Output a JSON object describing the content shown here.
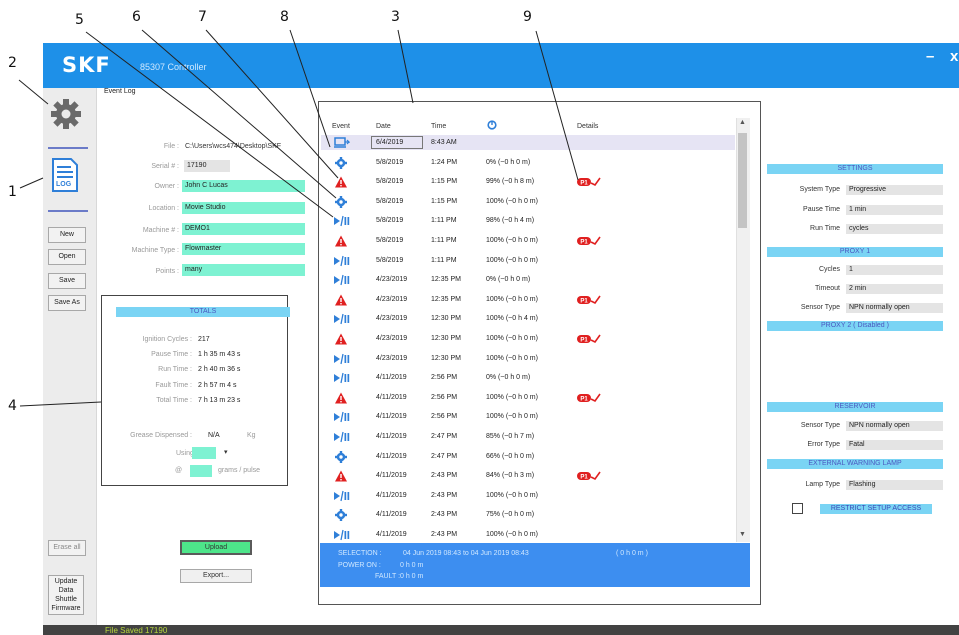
{
  "callouts": [
    "1",
    "2",
    "3",
    "4",
    "5",
    "6",
    "7",
    "8",
    "9"
  ],
  "window": {
    "logo_text": "SKF",
    "app_title": "85307 Controller",
    "minimize": "–",
    "close": "x"
  },
  "sidebar": {
    "log_label": "LOG",
    "buttons": [
      "New",
      "Open",
      "Save",
      "Save As"
    ],
    "erase_all": "Erase all",
    "update_lines": [
      "Update",
      "Data",
      "Shuttle",
      "Firmware"
    ]
  },
  "event_log_tab": "Event Log",
  "form": [
    {
      "label": "File :",
      "value": "C:\\Users\\wcs474\\Desktop\\SKF",
      "style": "plain"
    },
    {
      "label": "Serial # :",
      "value": "17190",
      "style": "gray"
    },
    {
      "label": "Owner :",
      "value": "John C Lucas",
      "style": "teal"
    },
    {
      "label": "Location :",
      "value": "Movie Studio",
      "style": "teal"
    },
    {
      "label": "Machine # :",
      "value": "DEMO1",
      "style": "teal"
    },
    {
      "label": "Machine Type :",
      "value": "Flowmaster",
      "style": "teal"
    },
    {
      "label": "Points :",
      "value": "many",
      "style": "teal"
    }
  ],
  "totals": {
    "header": "TOTALS",
    "rows": [
      {
        "label": "Ignition Cycles :",
        "value": "217"
      },
      {
        "label": "Pause Time :",
        "value": "1 h 35 m 43 s"
      },
      {
        "label": "Run Time :",
        "value": "2 h 40 m 36 s"
      },
      {
        "label": "Fault Time :",
        "value": "2 h 57 m 4 s"
      },
      {
        "label": "Total Time :",
        "value": "7 h 13 m 23 s"
      }
    ],
    "grease_label": "Grease Dispensed :",
    "grease_value": "N/A",
    "grease_unit": "Kg",
    "using_label": "Using",
    "at_label": "@",
    "pulse_unit": "grams / pulse"
  },
  "upload_label": "Upload",
  "export_label": "Export...",
  "table": {
    "headers": {
      "event": "Event",
      "date": "Date",
      "time": "Time",
      "details": "Details"
    },
    "rows": [
      {
        "event": "power",
        "date": "6/4/2019",
        "time": "8:43 AM",
        "details": "",
        "fault": false
      },
      {
        "event": "gear",
        "date": "5/8/2019",
        "time": "1:24 PM",
        "details": "0% (~0 h 0 m)",
        "fault": false
      },
      {
        "event": "warning",
        "date": "5/8/2019",
        "time": "1:15 PM",
        "details": "99% (~0 h 8 m)",
        "fault": true
      },
      {
        "event": "gear",
        "date": "5/8/2019",
        "time": "1:15 PM",
        "details": "100% (~0 h 0 m)",
        "fault": false
      },
      {
        "event": "play",
        "date": "5/8/2019",
        "time": "1:11 PM",
        "details": "98% (~0 h 4 m)",
        "fault": false
      },
      {
        "event": "warning",
        "date": "5/8/2019",
        "time": "1:11 PM",
        "details": "100% (~0 h 0 m)",
        "fault": true
      },
      {
        "event": "play",
        "date": "5/8/2019",
        "time": "1:11 PM",
        "details": "100% (~0 h 0 m)",
        "fault": false
      },
      {
        "event": "play",
        "date": "4/23/2019",
        "time": "12:35 PM",
        "details": "0% (~0 h 0 m)",
        "fault": false
      },
      {
        "event": "warning",
        "date": "4/23/2019",
        "time": "12:35 PM",
        "details": "100% (~0 h 0 m)",
        "fault": true
      },
      {
        "event": "play",
        "date": "4/23/2019",
        "time": "12:30 PM",
        "details": "100% (~0 h 4 m)",
        "fault": false
      },
      {
        "event": "warning",
        "date": "4/23/2019",
        "time": "12:30 PM",
        "details": "100% (~0 h 0 m)",
        "fault": true
      },
      {
        "event": "play",
        "date": "4/23/2019",
        "time": "12:30 PM",
        "details": "100% (~0 h 0 m)",
        "fault": false
      },
      {
        "event": "play",
        "date": "4/11/2019",
        "time": "2:56 PM",
        "details": "0% (~0 h 0 m)",
        "fault": false
      },
      {
        "event": "warning",
        "date": "4/11/2019",
        "time": "2:56 PM",
        "details": "100% (~0 h 0 m)",
        "fault": true
      },
      {
        "event": "play",
        "date": "4/11/2019",
        "time": "2:56 PM",
        "details": "100% (~0 h 0 m)",
        "fault": false
      },
      {
        "event": "play",
        "date": "4/11/2019",
        "time": "2:47 PM",
        "details": "85% (~0 h 7 m)",
        "fault": false
      },
      {
        "event": "gear",
        "date": "4/11/2019",
        "time": "2:47 PM",
        "details": "66% (~0 h 0 m)",
        "fault": false
      },
      {
        "event": "warning",
        "date": "4/11/2019",
        "time": "2:43 PM",
        "details": "84% (~0 h 3 m)",
        "fault": true
      },
      {
        "event": "play",
        "date": "4/11/2019",
        "time": "2:43 PM",
        "details": "100% (~0 h 0 m)",
        "fault": false
      },
      {
        "event": "gear",
        "date": "4/11/2019",
        "time": "2:43 PM",
        "details": "75% (~0 h 0 m)",
        "fault": false
      },
      {
        "event": "play",
        "date": "4/11/2019",
        "time": "2:43 PM",
        "details": "100% (~0 h 0 m)",
        "fault": false
      }
    ],
    "fault_badge": "P1"
  },
  "summary": {
    "selection_label": "SELECTION :",
    "selection_value": "04 Jun 2019 08:43  to  04 Jun 2019 08:43",
    "selection_duration": "( 0 h 0 m )",
    "power_label": "POWER ON :",
    "power_value": "0 h 0 m",
    "fault_label": "FAULT :",
    "fault_value": "0 h 0 m"
  },
  "settings": {
    "header": "SETTINGS",
    "rows": [
      {
        "label": "System Type",
        "value": "Progressive"
      },
      {
        "label": "Pause Time",
        "value": "1 min"
      },
      {
        "label": "Run Time",
        "value": "cycles"
      }
    ],
    "proxy1_header": "PROXY 1",
    "proxy1_rows": [
      {
        "label": "Cycles",
        "value": "1"
      },
      {
        "label": "Timeout",
        "value": "2 min"
      },
      {
        "label": "Sensor Type",
        "value": "NPN normally open"
      }
    ],
    "proxy2_header": "PROXY 2  ( Disabled )",
    "reservoir_header": "RESERVOIR",
    "reservoir_rows": [
      {
        "label": "Sensor Type",
        "value": "NPN normally open"
      },
      {
        "label": "Error Type",
        "value": "Fatal"
      }
    ],
    "lamp_header": "EXTERNAL WARNING LAMP",
    "lamp_rows": [
      {
        "label": "Lamp Type",
        "value": "Flashing"
      }
    ],
    "restrict_label": "RESTRICT SETUP ACCESS"
  },
  "status_bar": {
    "text": "File Saved  17190"
  },
  "colors": {
    "titlebar": "#1E90E8",
    "teal": "#7EF2D2",
    "section": "#7AD4F4",
    "event_blue": "#2F7FD8",
    "warning_red": "#E02020",
    "summary": "#3D8EF0"
  }
}
